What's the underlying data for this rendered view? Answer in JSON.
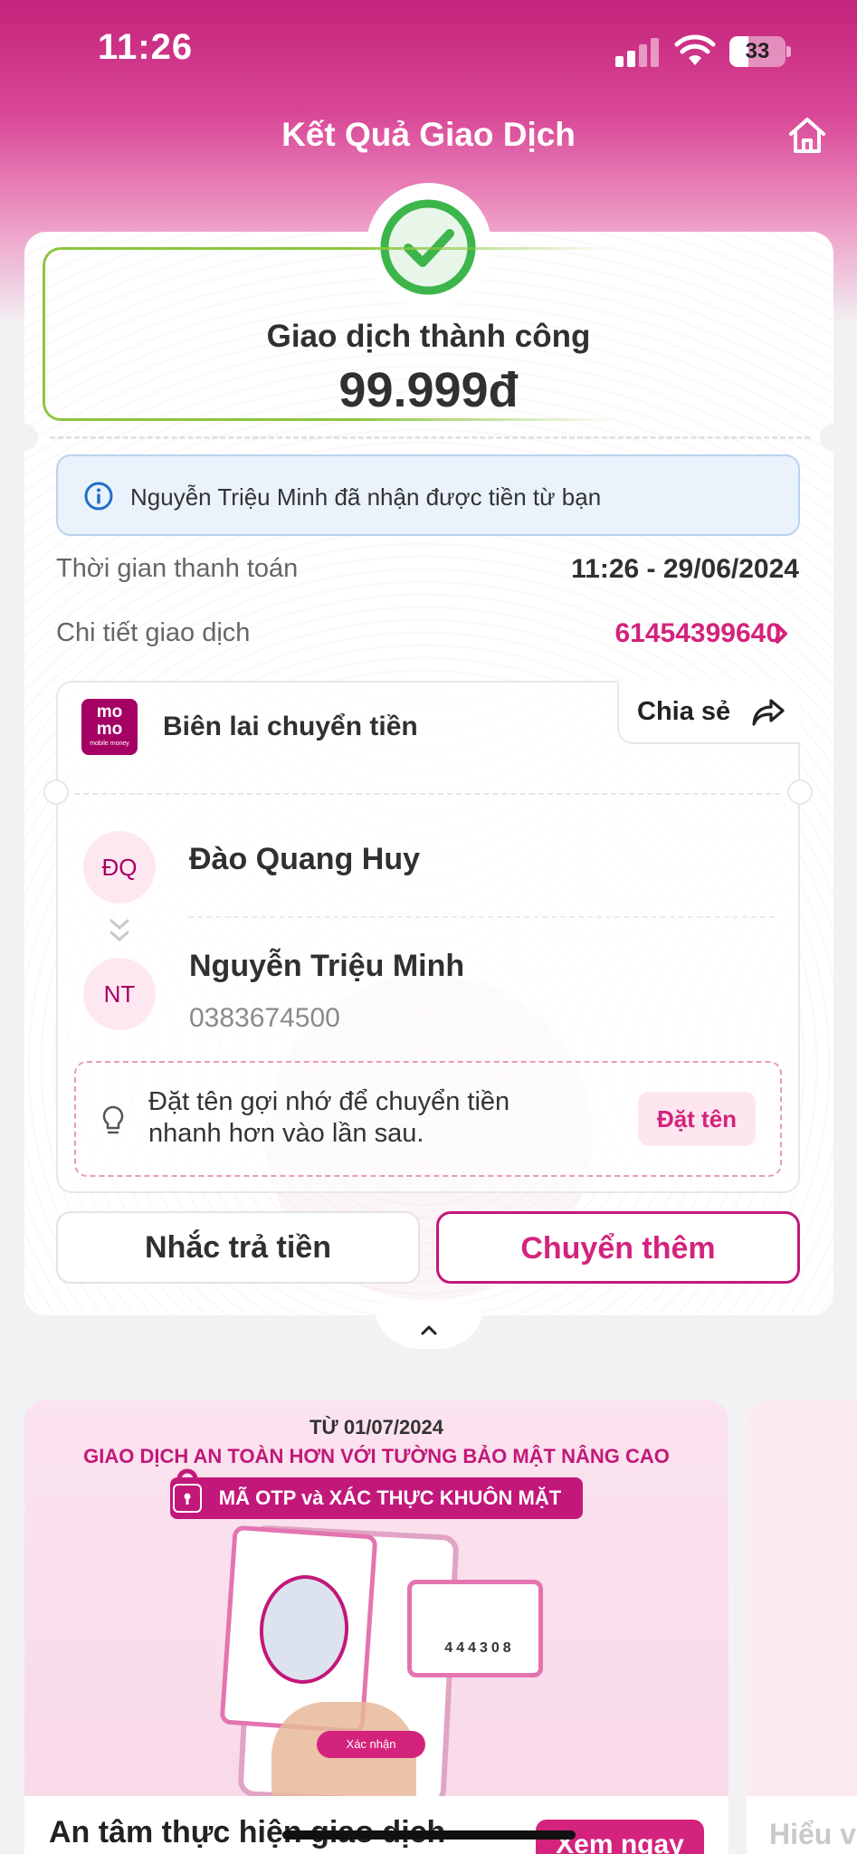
{
  "status_bar": {
    "time": "11:26",
    "battery": "33"
  },
  "nav": {
    "title": "Kết Quả Giao Dịch"
  },
  "result": {
    "status": "Giao dịch thành công",
    "amount": "99.999đ",
    "info": "Nguyễn Triệu Minh đã nhận được tiền từ bạn"
  },
  "details": [
    {
      "label": "Thời gian thanh toán",
      "value": "11:26 - 29/06/2024"
    },
    {
      "label": "Chi tiết giao dịch",
      "value": "61454399640"
    }
  ],
  "receipt": {
    "logo_line1": "mo",
    "logo_line2": "mo",
    "logo_line3": "mobile money",
    "title": "Biên lai chuyển tiền",
    "share_label": "Chia sẻ",
    "sender": {
      "initials": "ĐQ",
      "name": "Đào Quang Huy"
    },
    "receiver": {
      "initials": "NT",
      "name": "Nguyễn Triệu Minh",
      "phone": "0383674500"
    },
    "hint": "Đặt tên gợi nhớ để chuyển tiền nhanh hơn vào lần sau.",
    "hint_button": "Đặt tên"
  },
  "actions": {
    "remind": "Nhắc trả tiền",
    "transfer_more": "Chuyển thêm"
  },
  "promo": {
    "date": "TỪ 01/07/2024",
    "headline": "GIAO DỊCH AN TOÀN HƠN VỚI TƯỜNG BẢO MẬT NÂNG CAO",
    "tag": "MÃ OTP và XÁC THỰC KHUÔN MẶT",
    "otp_code": "444308",
    "confirm_label": "Xác nhận",
    "cta_text": "An tâm thực hiện giao dịch",
    "cta_button": "Xem ngay",
    "next_card_text": "Hiểu v"
  },
  "colors": {
    "brand": "#a50064",
    "accent": "#d3237d",
    "success": "#3cb54a"
  }
}
